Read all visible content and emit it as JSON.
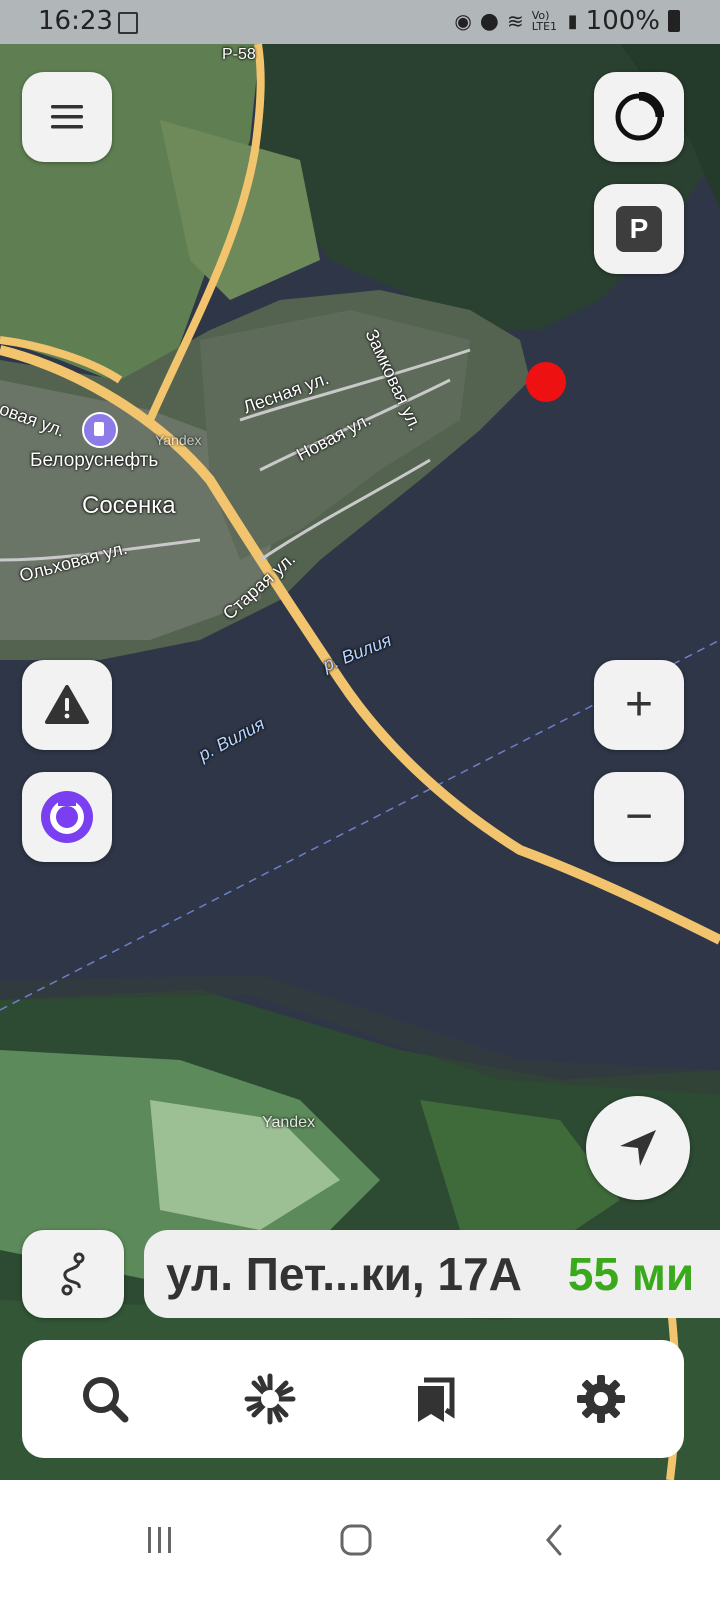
{
  "status_bar": {
    "time": "16:23",
    "network": "Vo) LTE1",
    "battery": "100%"
  },
  "map": {
    "road_label": "P-58",
    "village_name": "Сосенка",
    "gas_station": "Белоруснефть",
    "streets": [
      "Лесная ул.",
      "Замковая ул.",
      "Новая ул.",
      "Ольховая ул.",
      "Старая ул.",
      "овая ул."
    ],
    "river_label_1": "р. Вилия",
    "river_label_2": "р. Вилия",
    "watermark_1": "Yandex",
    "watermark_2": "Yandex"
  },
  "route": {
    "address": "ул. Пет...ки, 17А",
    "time": "55 ми"
  },
  "icons": {
    "menu": "menu-icon",
    "alice_app": "alice-ring-icon",
    "parking": "P",
    "alert": "warning-icon",
    "alice": "alice-icon",
    "zoom_in": "+",
    "zoom_out": "−",
    "locate": "navigation-arrow-icon",
    "route_options": "route-icon",
    "search": "search-icon",
    "discovery": "discovery-icon",
    "bookmarks": "bookmarks-icon",
    "settings": "gear-icon"
  },
  "colors": {
    "alice_purple": "#7b3ff2",
    "route_green": "#3aa91b",
    "marker_red": "#ee1111",
    "road_yellow": "#f2c46d",
    "water": "#2e3647"
  }
}
